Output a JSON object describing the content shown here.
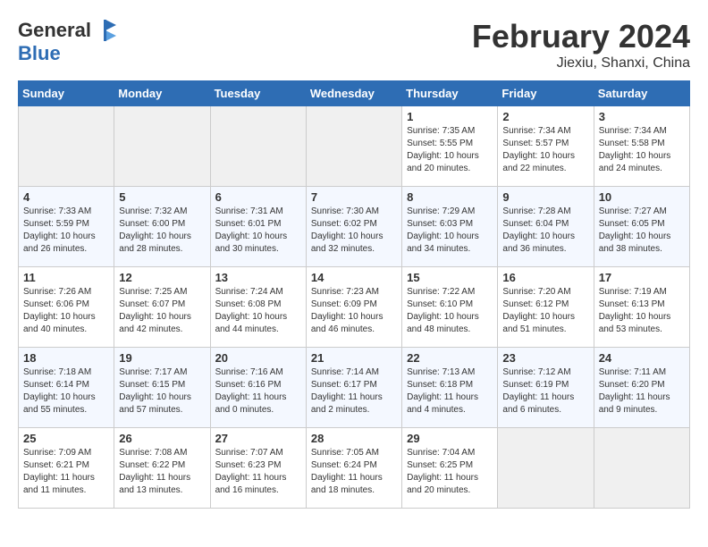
{
  "header": {
    "logo_line1": "General",
    "logo_line2": "Blue",
    "title": "February 2024",
    "subtitle": "Jiexiu, Shanxi, China"
  },
  "weekdays": [
    "Sunday",
    "Monday",
    "Tuesday",
    "Wednesday",
    "Thursday",
    "Friday",
    "Saturday"
  ],
  "weeks": [
    [
      {
        "day": "",
        "empty": true
      },
      {
        "day": "",
        "empty": true
      },
      {
        "day": "",
        "empty": true
      },
      {
        "day": "",
        "empty": true
      },
      {
        "day": "1",
        "sunrise": "7:35 AM",
        "sunset": "5:55 PM",
        "daylight": "10 hours and 20 minutes."
      },
      {
        "day": "2",
        "sunrise": "7:34 AM",
        "sunset": "5:57 PM",
        "daylight": "10 hours and 22 minutes."
      },
      {
        "day": "3",
        "sunrise": "7:34 AM",
        "sunset": "5:58 PM",
        "daylight": "10 hours and 24 minutes."
      }
    ],
    [
      {
        "day": "4",
        "sunrise": "7:33 AM",
        "sunset": "5:59 PM",
        "daylight": "10 hours and 26 minutes."
      },
      {
        "day": "5",
        "sunrise": "7:32 AM",
        "sunset": "6:00 PM",
        "daylight": "10 hours and 28 minutes."
      },
      {
        "day": "6",
        "sunrise": "7:31 AM",
        "sunset": "6:01 PM",
        "daylight": "10 hours and 30 minutes."
      },
      {
        "day": "7",
        "sunrise": "7:30 AM",
        "sunset": "6:02 PM",
        "daylight": "10 hours and 32 minutes."
      },
      {
        "day": "8",
        "sunrise": "7:29 AM",
        "sunset": "6:03 PM",
        "daylight": "10 hours and 34 minutes."
      },
      {
        "day": "9",
        "sunrise": "7:28 AM",
        "sunset": "6:04 PM",
        "daylight": "10 hours and 36 minutes."
      },
      {
        "day": "10",
        "sunrise": "7:27 AM",
        "sunset": "6:05 PM",
        "daylight": "10 hours and 38 minutes."
      }
    ],
    [
      {
        "day": "11",
        "sunrise": "7:26 AM",
        "sunset": "6:06 PM",
        "daylight": "10 hours and 40 minutes."
      },
      {
        "day": "12",
        "sunrise": "7:25 AM",
        "sunset": "6:07 PM",
        "daylight": "10 hours and 42 minutes."
      },
      {
        "day": "13",
        "sunrise": "7:24 AM",
        "sunset": "6:08 PM",
        "daylight": "10 hours and 44 minutes."
      },
      {
        "day": "14",
        "sunrise": "7:23 AM",
        "sunset": "6:09 PM",
        "daylight": "10 hours and 46 minutes."
      },
      {
        "day": "15",
        "sunrise": "7:22 AM",
        "sunset": "6:10 PM",
        "daylight": "10 hours and 48 minutes."
      },
      {
        "day": "16",
        "sunrise": "7:20 AM",
        "sunset": "6:12 PM",
        "daylight": "10 hours and 51 minutes."
      },
      {
        "day": "17",
        "sunrise": "7:19 AM",
        "sunset": "6:13 PM",
        "daylight": "10 hours and 53 minutes."
      }
    ],
    [
      {
        "day": "18",
        "sunrise": "7:18 AM",
        "sunset": "6:14 PM",
        "daylight": "10 hours and 55 minutes."
      },
      {
        "day": "19",
        "sunrise": "7:17 AM",
        "sunset": "6:15 PM",
        "daylight": "10 hours and 57 minutes."
      },
      {
        "day": "20",
        "sunrise": "7:16 AM",
        "sunset": "6:16 PM",
        "daylight": "11 hours and 0 minutes."
      },
      {
        "day": "21",
        "sunrise": "7:14 AM",
        "sunset": "6:17 PM",
        "daylight": "11 hours and 2 minutes."
      },
      {
        "day": "22",
        "sunrise": "7:13 AM",
        "sunset": "6:18 PM",
        "daylight": "11 hours and 4 minutes."
      },
      {
        "day": "23",
        "sunrise": "7:12 AM",
        "sunset": "6:19 PM",
        "daylight": "11 hours and 6 minutes."
      },
      {
        "day": "24",
        "sunrise": "7:11 AM",
        "sunset": "6:20 PM",
        "daylight": "11 hours and 9 minutes."
      }
    ],
    [
      {
        "day": "25",
        "sunrise": "7:09 AM",
        "sunset": "6:21 PM",
        "daylight": "11 hours and 11 minutes."
      },
      {
        "day": "26",
        "sunrise": "7:08 AM",
        "sunset": "6:22 PM",
        "daylight": "11 hours and 13 minutes."
      },
      {
        "day": "27",
        "sunrise": "7:07 AM",
        "sunset": "6:23 PM",
        "daylight": "11 hours and 16 minutes."
      },
      {
        "day": "28",
        "sunrise": "7:05 AM",
        "sunset": "6:24 PM",
        "daylight": "11 hours and 18 minutes."
      },
      {
        "day": "29",
        "sunrise": "7:04 AM",
        "sunset": "6:25 PM",
        "daylight": "11 hours and 20 minutes."
      },
      {
        "day": "",
        "empty": true
      },
      {
        "day": "",
        "empty": true
      }
    ]
  ]
}
